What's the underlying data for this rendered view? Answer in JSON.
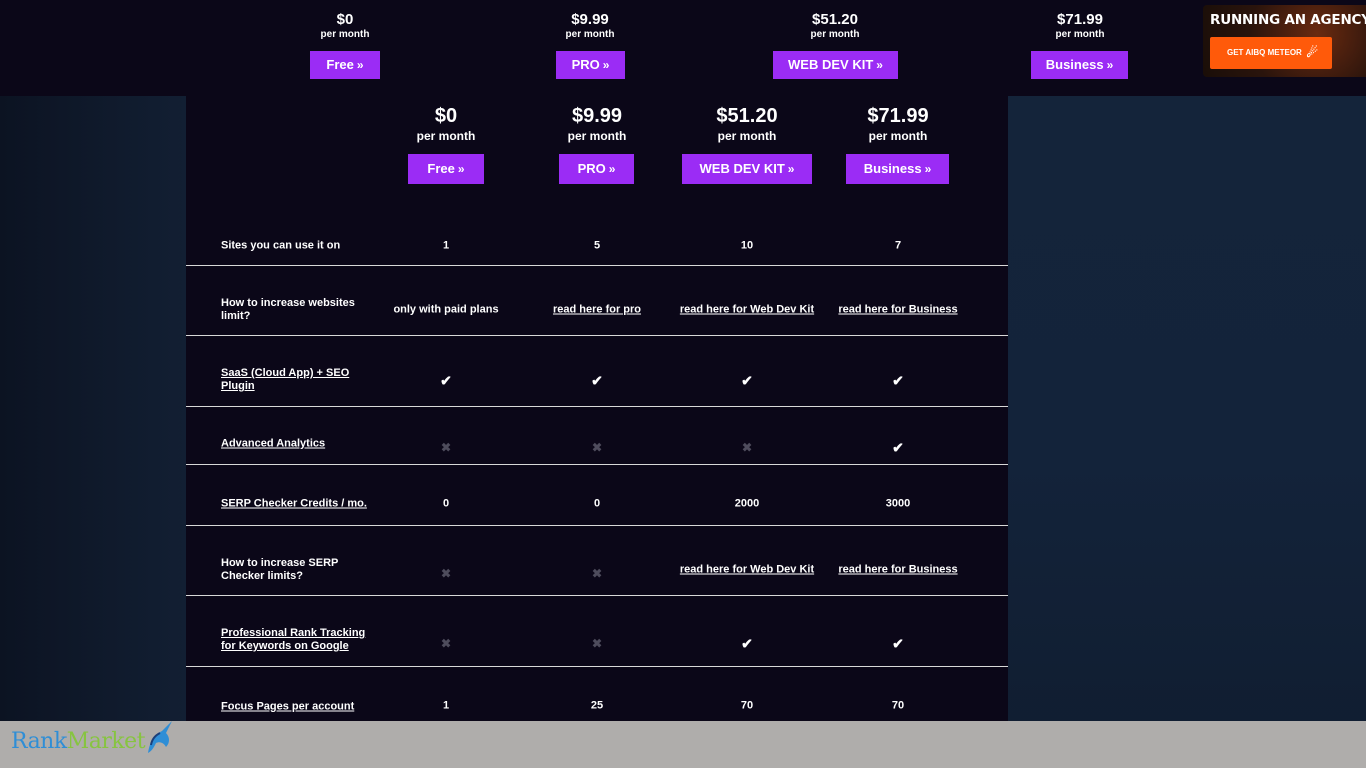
{
  "plans": [
    {
      "price": "$0",
      "per": "per month",
      "button": "Free"
    },
    {
      "price": "$9.99",
      "per": "per month",
      "button": "PRO"
    },
    {
      "price": "$51.20",
      "per": "per month",
      "button": "WEB DEV KIT"
    },
    {
      "price": "$71.99",
      "per": "per month",
      "button": "Business"
    }
  ],
  "ad": {
    "title": "RUNNING AN AGENCY?",
    "button": "GET AIBQ METEOR"
  },
  "rows": [
    {
      "label": "Sites you can use it on",
      "values": [
        "1",
        "5",
        "10",
        "7"
      ]
    },
    {
      "label": "How to increase websites limit?",
      "values": [
        "only with paid plans",
        "read here for pro",
        "read here for Web Dev Kit",
        "read here for Business"
      ]
    },
    {
      "label": "SaaS (Cloud App) + SEO Plugin",
      "values": [
        "✔",
        "✔",
        "✔",
        "✔"
      ]
    },
    {
      "label": "Advanced Analytics",
      "values": [
        "✖",
        "✖",
        "✖",
        "✔"
      ]
    },
    {
      "label": "SERP Checker Credits / mo.",
      "values": [
        "0",
        "0",
        "2000",
        "3000"
      ]
    },
    {
      "label": "How to increase SERP Checker limits?",
      "values": [
        "✖",
        "✖",
        "read here for Web Dev Kit",
        "read here for Business"
      ]
    },
    {
      "label": "Professional Rank Tracking for Keywords on Google",
      "values": [
        "✖",
        "✖",
        "✔",
        "✔"
      ]
    },
    {
      "label": "Focus Pages per account",
      "values": [
        "1",
        "25",
        "70",
        "70"
      ]
    }
  ],
  "icons": {
    "check": "check-icon",
    "cross": "cross-icon",
    "chevron": "double-chevron-right-icon",
    "meteor": "meteor-icon",
    "unicorn": "unicorn-icon"
  },
  "colors": {
    "accent": "#9b2cf5",
    "ad_button": "#ff5a0a",
    "panel": "#0b0718"
  },
  "footer": {
    "logo_part1": "Rank",
    "logo_part2": "Market"
  }
}
